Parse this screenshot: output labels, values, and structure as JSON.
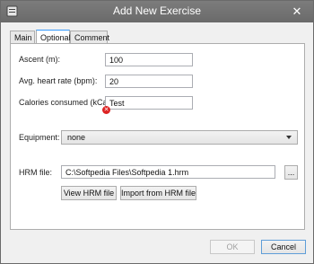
{
  "window": {
    "title": "Add New Exercise"
  },
  "tabs": [
    {
      "label": "Main"
    },
    {
      "label": "Optional"
    },
    {
      "label": "Comment"
    }
  ],
  "fields": {
    "ascent": {
      "label": "Ascent (m):",
      "value": "100"
    },
    "heart_rate": {
      "label": "Avg. heart rate (bpm):",
      "value": "20"
    },
    "calories": {
      "label": "Calories consumed (kCal):",
      "value": "Test"
    },
    "equipment": {
      "label": "Equipment:",
      "selected": "none"
    },
    "hrm_file": {
      "label": "HRM file:",
      "value": "C:\\Softpedia Files\\Softpedia 1.hrm",
      "browse_label": "..."
    }
  },
  "buttons": {
    "view_hrm": "View HRM file",
    "import_hrm": "Import from HRM file",
    "ok": "OK",
    "cancel": "Cancel"
  },
  "colors": {
    "titlebar": "#6d6d6d",
    "error": "#dd2222",
    "accent": "#3399ff"
  },
  "icons": {
    "app": "app-icon",
    "close": "close-icon",
    "error": "error-icon",
    "dropdown": "chevron-down-icon"
  }
}
